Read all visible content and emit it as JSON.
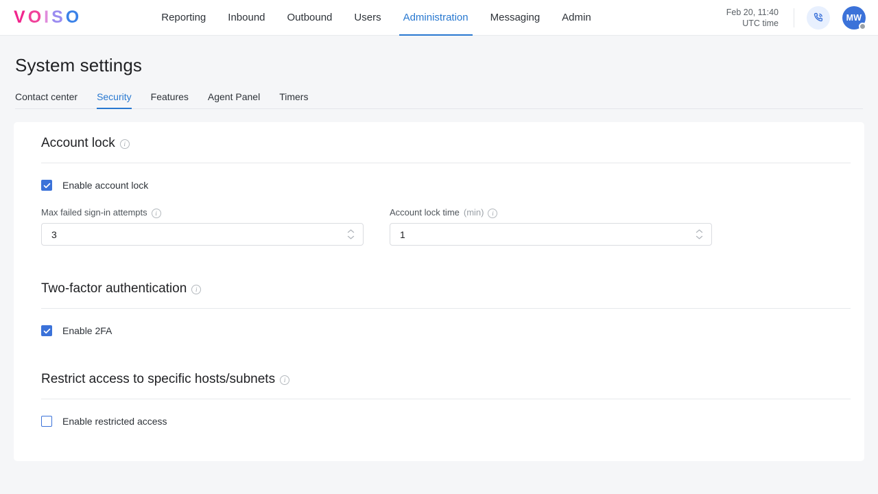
{
  "app": {
    "logo_letters": [
      {
        "char": "V",
        "color": "#f1258d"
      },
      {
        "char": "O",
        "color": "#f0419a"
      },
      {
        "char": "I",
        "color": "#e08cdc"
      },
      {
        "char": "S",
        "color": "#9b8cf0"
      },
      {
        "char": "O",
        "color": "#3b82e8"
      }
    ]
  },
  "topnav": {
    "items": [
      {
        "label": "Reporting",
        "active": false
      },
      {
        "label": "Inbound",
        "active": false
      },
      {
        "label": "Outbound",
        "active": false
      },
      {
        "label": "Users",
        "active": false
      },
      {
        "label": "Administration",
        "active": true
      },
      {
        "label": "Messaging",
        "active": false
      },
      {
        "label": "Admin",
        "active": false
      }
    ],
    "clock_line1": "Feb 20, 11:40",
    "clock_line2": "UTC time",
    "phone_icon": "phone-with-waves-icon",
    "avatar_initials": "MW",
    "avatar_status_color": "#9aa0a6",
    "accent_color": "#2878d0"
  },
  "page": {
    "title": "System settings",
    "tabs": [
      {
        "label": "Contact center",
        "active": false
      },
      {
        "label": "Security",
        "active": true
      },
      {
        "label": "Features",
        "active": false
      },
      {
        "label": "Agent Panel",
        "active": false
      },
      {
        "label": "Timers",
        "active": false
      }
    ]
  },
  "sections": {
    "account_lock": {
      "title": "Account lock",
      "info_icon": "info-icon",
      "enable_label": "Enable account lock",
      "enable_checked": true,
      "fields": [
        {
          "label": "Max failed sign-in attempts",
          "unit": "",
          "value": "3",
          "info_icon": "info-icon"
        },
        {
          "label": "Account lock time",
          "unit": "(min)",
          "value": "1",
          "info_icon": "info-icon"
        }
      ]
    },
    "two_factor": {
      "title": "Two-factor authentication",
      "info_icon": "info-icon",
      "enable_label": "Enable 2FA",
      "enable_checked": true
    },
    "restrict_access": {
      "title": "Restrict access to specific hosts/subnets",
      "info_icon": "info-icon",
      "enable_label": "Enable restricted access",
      "enable_checked": false
    }
  }
}
